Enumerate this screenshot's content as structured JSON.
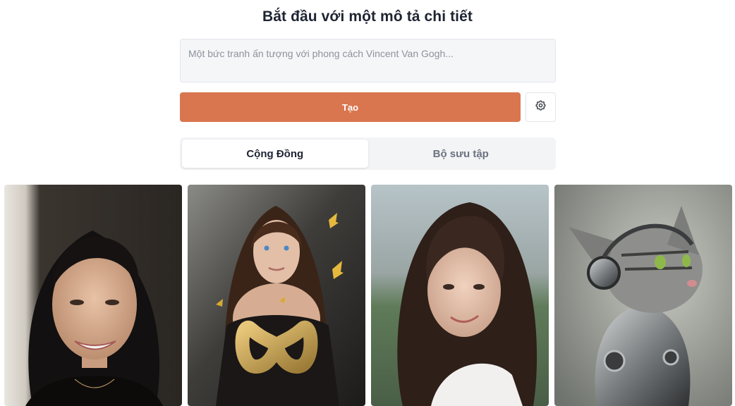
{
  "header": {
    "title": "Bắt đầu với một mô tả chi tiết"
  },
  "prompt": {
    "placeholder": "Một bức tranh ấn tượng với phong cách Vincent Van Gogh...",
    "value": ""
  },
  "actions": {
    "generate_label": "Tạo",
    "settings_icon": "gear-icon"
  },
  "tabs": [
    {
      "label": "Cộng Đồng",
      "active": true
    },
    {
      "label": "Bộ sưu tập",
      "active": false
    }
  ],
  "colors": {
    "accent": "#d9764f",
    "tab_bg": "#f3f4f6"
  }
}
